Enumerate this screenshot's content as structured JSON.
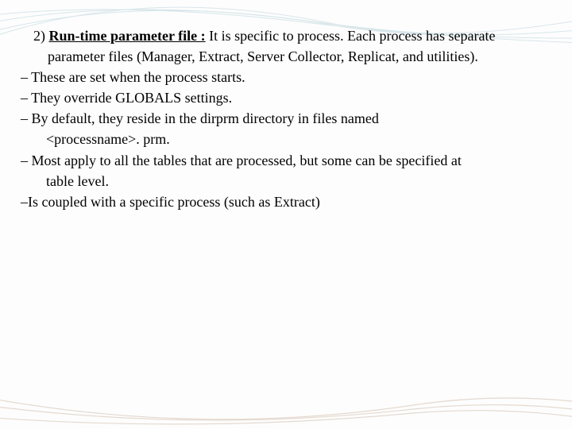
{
  "heading": {
    "number": "2)",
    "title": "Run-time parameter file :",
    "rest": "It is specific  to process. Each process has separate parameter files (Manager, Extract, Server Collector, Replicat, and utilities)."
  },
  "bullets": [
    "– These are set when the process starts.",
    "– They override GLOBALS settings.",
    "– By default, they reside in the dirprm directory in files named",
    "– Most apply to all the tables that are processed, but some can be specified at",
    "–Is coupled with a specific process (such as Extract)"
  ],
  "wraps": {
    "b3": "<processname>. prm.",
    "b4": "table level."
  }
}
